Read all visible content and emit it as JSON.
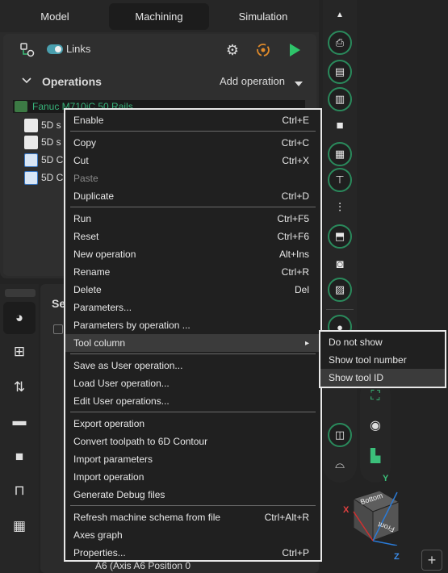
{
  "tabs": [
    "Model",
    "Machining",
    "Simulation"
  ],
  "toolbar": {
    "links_label": "Links"
  },
  "operations": {
    "title": "Operations",
    "add_label": "Add operation"
  },
  "tree": {
    "machine": "Fanuc M710iC 50 Rails",
    "rows": [
      "5D s",
      "5D s",
      "5D C",
      "5D C"
    ]
  },
  "bottom_panel": {
    "section_label": "Se",
    "visible_row": "A6 (Axis A6 Position 0"
  },
  "context_menu": {
    "groups": [
      [
        {
          "label": "Enable",
          "shortcut": "Ctrl+E"
        }
      ],
      [
        {
          "label": "Copy",
          "shortcut": "Ctrl+C"
        },
        {
          "label": "Cut",
          "shortcut": "Ctrl+X"
        },
        {
          "label": "Paste",
          "shortcut": ""
        },
        {
          "label": "Duplicate",
          "shortcut": "Ctrl+D"
        }
      ],
      [
        {
          "label": "Run",
          "shortcut": "Ctrl+F5"
        },
        {
          "label": "Reset",
          "shortcut": "Ctrl+F6"
        },
        {
          "label": "New operation",
          "shortcut": "Alt+Ins"
        },
        {
          "label": "Rename",
          "shortcut": "Ctrl+R"
        },
        {
          "label": "Delete",
          "shortcut": "Del"
        },
        {
          "label": "Parameters...",
          "shortcut": ""
        },
        {
          "label": "Parameters by operation ...",
          "shortcut": ""
        },
        {
          "label": "Tool column",
          "shortcut": "▸"
        }
      ],
      [
        {
          "label": "Save as User operation...",
          "shortcut": ""
        },
        {
          "label": "Load User operation...",
          "shortcut": ""
        },
        {
          "label": "Edit User operations...",
          "shortcut": ""
        }
      ],
      [
        {
          "label": "Export operation",
          "shortcut": ""
        },
        {
          "label": "Convert toolpath to 6D Contour",
          "shortcut": ""
        },
        {
          "label": "Import parameters",
          "shortcut": ""
        },
        {
          "label": "Import operation",
          "shortcut": ""
        },
        {
          "label": "Generate Debug files",
          "shortcut": ""
        }
      ],
      [
        {
          "label": "Refresh machine schema from file",
          "shortcut": "Ctrl+Alt+R"
        },
        {
          "label": "Axes graph",
          "shortcut": ""
        },
        {
          "label": "Properties...",
          "shortcut": "Ctrl+P"
        }
      ]
    ],
    "disabled": [
      "Paste"
    ],
    "highlighted": "Tool column"
  },
  "submenu": {
    "items": [
      "Do not show",
      "Show tool number",
      "Show tool ID"
    ],
    "highlighted": "Show tool ID"
  },
  "view_cube": {
    "top": "Bottom",
    "front": "Front",
    "axis_x": "X",
    "axis_y": "Y",
    "axis_z": "Z"
  },
  "colors": {
    "accent_green": "#2a8a5c",
    "machine_text": "#37b37a",
    "toggle": "#4a9fae"
  }
}
